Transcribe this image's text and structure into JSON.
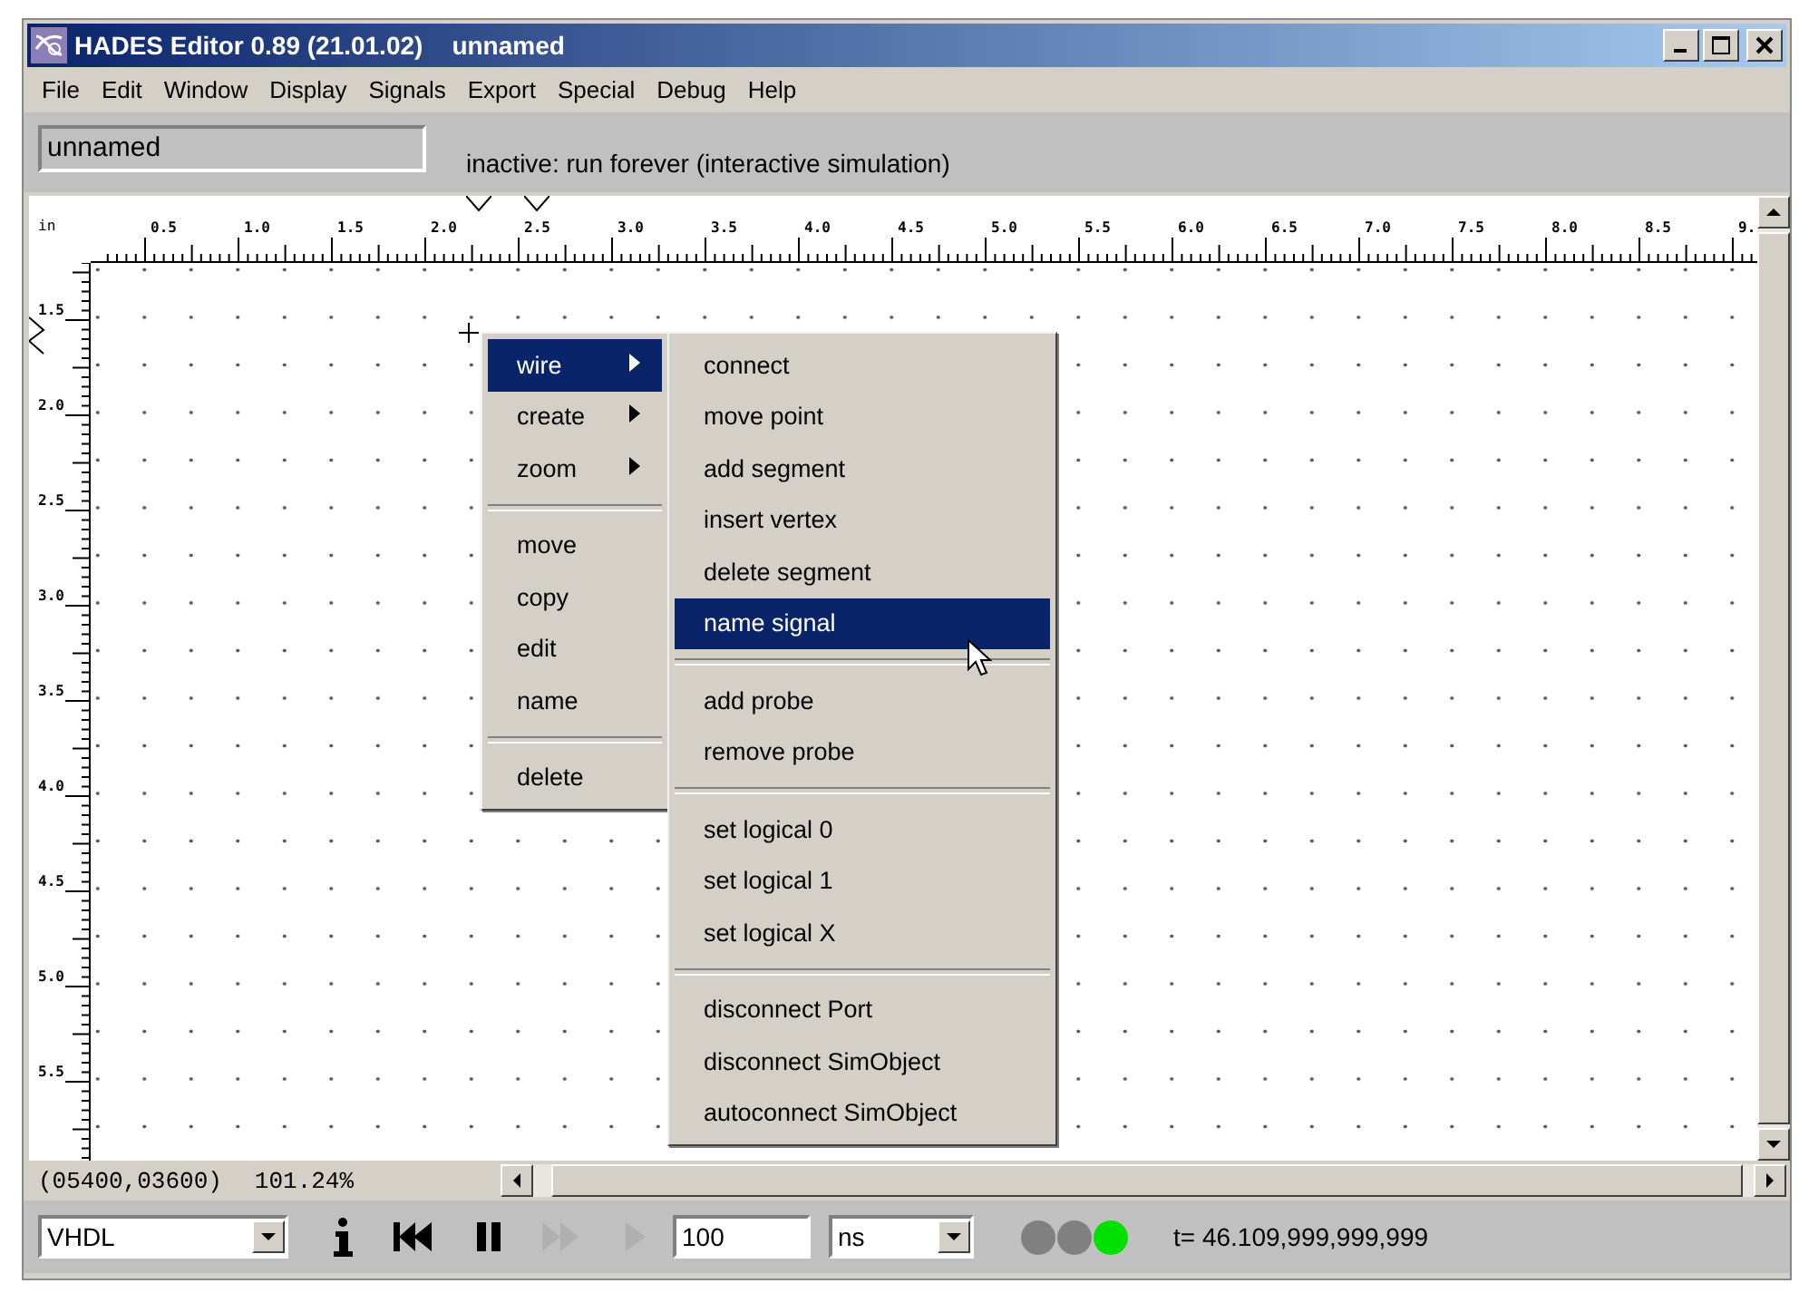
{
  "window": {
    "title": "HADES Editor 0.89 (21.01.02)",
    "document": "unnamed"
  },
  "menu": [
    "File",
    "Edit",
    "Window",
    "Display",
    "Signals",
    "Export",
    "Special",
    "Debug",
    "Help"
  ],
  "toolbar": {
    "name_field": "unnamed",
    "status": "inactive: run forever (interactive simulation)"
  },
  "ruler": {
    "unit": "in",
    "x_labels": [
      "0.5",
      "1.0",
      "1.5",
      "2.0",
      "2.5",
      "3.0",
      "3.5",
      "4.0",
      "4.5",
      "5.0",
      "5.5",
      "6.0",
      "6.5",
      "7.0",
      "7.5",
      "8.0",
      "8.5",
      "9."
    ],
    "y_labels": [
      "1.5",
      "2.0",
      "2.5",
      "3.0",
      "3.5",
      "4.0",
      "4.5",
      "5.0",
      "5.5"
    ]
  },
  "context_menu": [
    {
      "kind": "item",
      "label": "wire",
      "submenu": true,
      "selected": true
    },
    {
      "kind": "item",
      "label": "create",
      "submenu": true,
      "selected": false
    },
    {
      "kind": "item",
      "label": "zoom",
      "submenu": true,
      "selected": false
    },
    {
      "kind": "separator"
    },
    {
      "kind": "item",
      "label": "move",
      "submenu": false,
      "selected": false
    },
    {
      "kind": "item",
      "label": "copy",
      "submenu": false,
      "selected": false
    },
    {
      "kind": "item",
      "label": "edit",
      "submenu": false,
      "selected": false
    },
    {
      "kind": "item",
      "label": "name",
      "submenu": false,
      "selected": false
    },
    {
      "kind": "separator"
    },
    {
      "kind": "item",
      "label": "delete",
      "submenu": false,
      "selected": false
    }
  ],
  "submenu": [
    {
      "kind": "item",
      "label": "connect",
      "selected": false
    },
    {
      "kind": "item",
      "label": "move point",
      "selected": false
    },
    {
      "kind": "item",
      "label": "add segment",
      "selected": false
    },
    {
      "kind": "item",
      "label": "insert vertex",
      "selected": false
    },
    {
      "kind": "item",
      "label": "delete segment",
      "selected": false
    },
    {
      "kind": "item",
      "label": "name signal",
      "selected": true
    },
    {
      "kind": "separator"
    },
    {
      "kind": "item",
      "label": "add probe",
      "selected": false
    },
    {
      "kind": "item",
      "label": "remove probe",
      "selected": false
    },
    {
      "kind": "separator"
    },
    {
      "kind": "item",
      "label": "set logical 0",
      "selected": false
    },
    {
      "kind": "item",
      "label": "set logical 1",
      "selected": false
    },
    {
      "kind": "item",
      "label": "set logical X",
      "selected": false
    },
    {
      "kind": "separator"
    },
    {
      "kind": "item",
      "label": "disconnect Port",
      "selected": false
    },
    {
      "kind": "item",
      "label": "disconnect SimObject",
      "selected": false
    },
    {
      "kind": "item",
      "label": "autoconnect SimObject",
      "selected": false
    }
  ],
  "status": {
    "coordinates": "(05400,03600)",
    "zoom": "101.24%"
  },
  "controls": {
    "language": "VHDL",
    "step": "100",
    "unit": "ns",
    "time": "t= 46.109,999,999,999"
  },
  "playback": [
    {
      "kind": "info",
      "disabled": false
    },
    {
      "kind": "rewind",
      "disabled": false
    },
    {
      "kind": "pause",
      "disabled": false
    },
    {
      "kind": "fast-forward",
      "disabled": true
    },
    {
      "kind": "play",
      "disabled": true
    }
  ],
  "lights": [
    {
      "color": "#808080"
    },
    {
      "color": "#808080"
    },
    {
      "color": "#00e000"
    }
  ]
}
